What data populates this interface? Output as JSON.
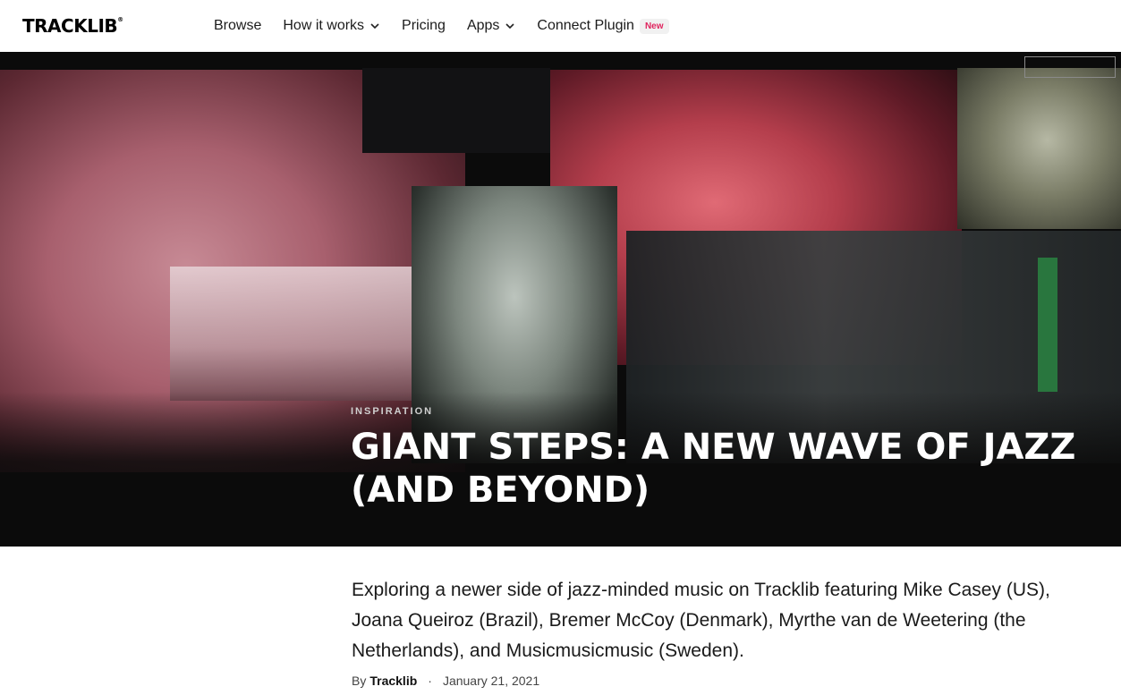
{
  "brand": {
    "logo": "TRACKLIB",
    "logo_mark": "®"
  },
  "nav": {
    "browse": "Browse",
    "how_it_works": "How it works",
    "pricing": "Pricing",
    "apps": "Apps",
    "connect_plugin": "Connect Plugin",
    "new_badge": "New"
  },
  "article": {
    "category": "INSPIRATION",
    "title": "GIANT STEPS: A NEW WAVE OF JAZZ (AND BEYOND)",
    "intro": "Exploring a newer side of jazz-minded music on Tracklib featuring Mike Casey (US), Joana Queiroz (Brazil), Bremer McCoy (Denmark), Myrthe van de Weetering (the Netherlands), and Musicmusicmusic (Sweden).",
    "by_label": "By",
    "author": "Tracklib",
    "separator": "·",
    "date": "January 21, 2021"
  },
  "colors": {
    "badge_text": "#e0245e",
    "hero_bg": "#0b0b0b"
  },
  "icons": {
    "dropdown": "chevron-down-icon"
  }
}
